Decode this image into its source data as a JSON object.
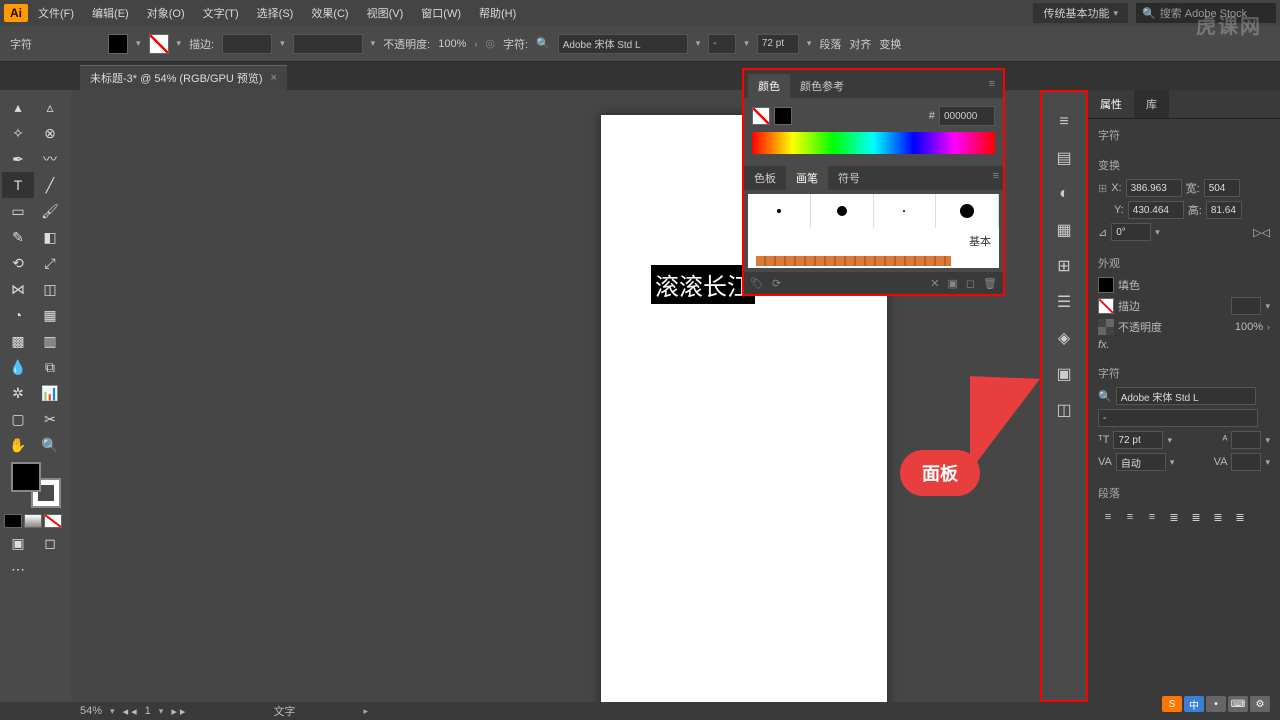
{
  "app": {
    "logo": "Ai"
  },
  "menu": {
    "file": "文件(F)",
    "edit": "编辑(E)",
    "object": "对象(O)",
    "type": "文字(T)",
    "select": "选择(S)",
    "effect": "效果(C)",
    "view": "视图(V)",
    "window": "窗口(W)",
    "help": "帮助(H)"
  },
  "menubar_right": {
    "workspace": "传统基本功能",
    "search_placeholder": "搜索 Adobe Stock"
  },
  "optbar": {
    "label_chars": "字符",
    "stroke_label": "描边:",
    "opacity_label": "不透明度:",
    "opacity_value": "100%",
    "char_label": "字符:",
    "font": "Adobe 宋体 Std L",
    "weight": "-",
    "size": "72 pt",
    "paragraph": "段落",
    "align": "对齐",
    "transform": "变换"
  },
  "document": {
    "tab_title": "未标题-3* @ 54% (RGB/GPU 预览)"
  },
  "canvas": {
    "text": "滚滚长江"
  },
  "float_panel": {
    "tab_color": "颜色",
    "tab_ref": "颜色参考",
    "hex_prefix": "#",
    "hex": "000000",
    "sub_swatch": "色板",
    "sub_brush": "画笔",
    "sub_symbol": "符号",
    "basic": "基本"
  },
  "right": {
    "tab_props": "属性",
    "tab_lib": "库",
    "sec_char": "字符",
    "sec_transform": "变换",
    "x_label": "X:",
    "x": "386.963",
    "w_label": "宽:",
    "w": "504",
    "y_label": "Y:",
    "y": "430.464",
    "h_label": "高:",
    "h": "81.64",
    "angle": "0°",
    "sec_appearance": "外观",
    "fill": "填色",
    "stroke": "描边",
    "opacity": "不透明度",
    "opacity_v": "100%",
    "sec_char2": "字符",
    "font_family": "Adobe 宋体 Std L",
    "font_weight": "-",
    "font_size": "72 pt",
    "auto": "自动",
    "sec_para": "段落"
  },
  "callout": {
    "label": "面板"
  },
  "statusbar": {
    "zoom": "54%",
    "page": "1",
    "type": "文字"
  },
  "watermark": "虎课网"
}
